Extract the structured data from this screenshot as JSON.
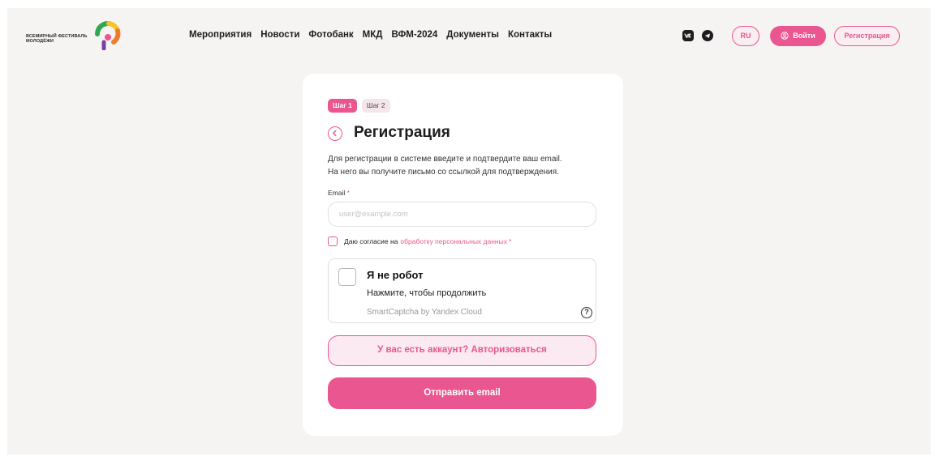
{
  "header": {
    "logo_line1": "ВСЕМИРНЫЙ ФЕСТИВАЛЬ",
    "logo_line2": "МОЛОДЁЖИ",
    "nav": [
      "Мероприятия",
      "Новости",
      "Фотобанк",
      "МКД",
      "ВФМ-2024",
      "Документы",
      "Контакты"
    ],
    "lang_label": "RU",
    "login_label": "Войти",
    "register_label": "Регистрация"
  },
  "form": {
    "step1": "Шаг 1",
    "step2": "Шаг 2",
    "title": "Регистрация",
    "desc_line1": "Для регистрации в системе введите и подтвердите ваш email.",
    "desc_line2": "На него вы получите письмо со ссылкой для подтверждения.",
    "email_label": "Email",
    "required_mark": "*",
    "email_placeholder": "user@example.com",
    "consent_text": "Даю согласие на",
    "consent_link": "обработку персональных данных",
    "captcha_title": "Я не робот",
    "captcha_sub": "Нажмите, чтобы продолжить",
    "captcha_brand": "SmartCaptcha by Yandex Cloud",
    "captcha_help": "?",
    "have_account_label": "У вас есть аккаунт? Авторизоваться",
    "submit_label": "Отправить email"
  },
  "colors": {
    "accent": "#ea5690",
    "background": "#f6f4f2"
  }
}
